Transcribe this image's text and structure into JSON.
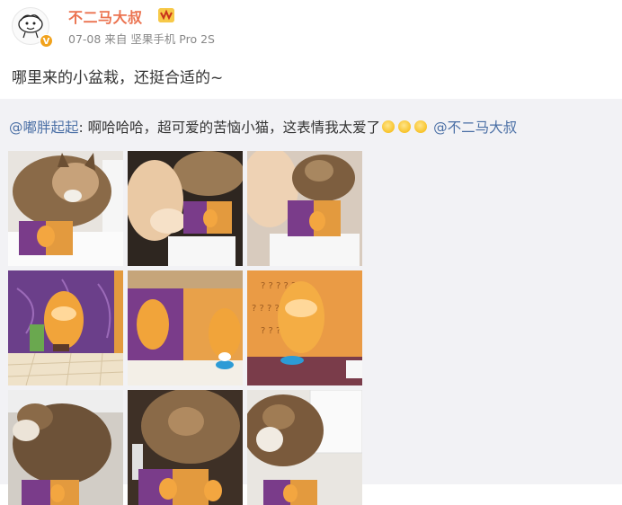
{
  "author": {
    "name": "不二马大叔",
    "verified_mark": "V"
  },
  "meta": {
    "date": "07-08",
    "source_prefix": "来自",
    "source": "坚果手机 Pro 2S"
  },
  "post": {
    "text": "哪里来的小盆栽，还挺合适的~"
  },
  "repost": {
    "user": "@嘟胖起起",
    "text": ": 啊哈哈哈，超可爱的苦恼小猫，这表情我太爱了",
    "mention": "@不二马大叔"
  },
  "icons": [
    "avatar-cartoon-icon",
    "verified-v-icon",
    "vip-badge-icon",
    "worried-emoji-icon"
  ],
  "colors": {
    "username": "#eb7350",
    "link": "#4a6fa5",
    "repost_bg": "#f2f2f5",
    "meta": "#888888"
  },
  "photos": [
    {
      "label": "cat with figurine scene 1"
    },
    {
      "label": "cream cat sniffing figurine"
    },
    {
      "label": "cream cat and tabby cat with figurine"
    },
    {
      "label": "figurine with purple wall and plant"
    },
    {
      "label": "figurine close-up purple and orange walls"
    },
    {
      "label": "figurine with orange question-mark wall"
    },
    {
      "label": "tabby cat looking down at figurine"
    },
    {
      "label": "tabby cat head close-up"
    },
    {
      "label": "tabby cat sitting beside figurine"
    }
  ]
}
